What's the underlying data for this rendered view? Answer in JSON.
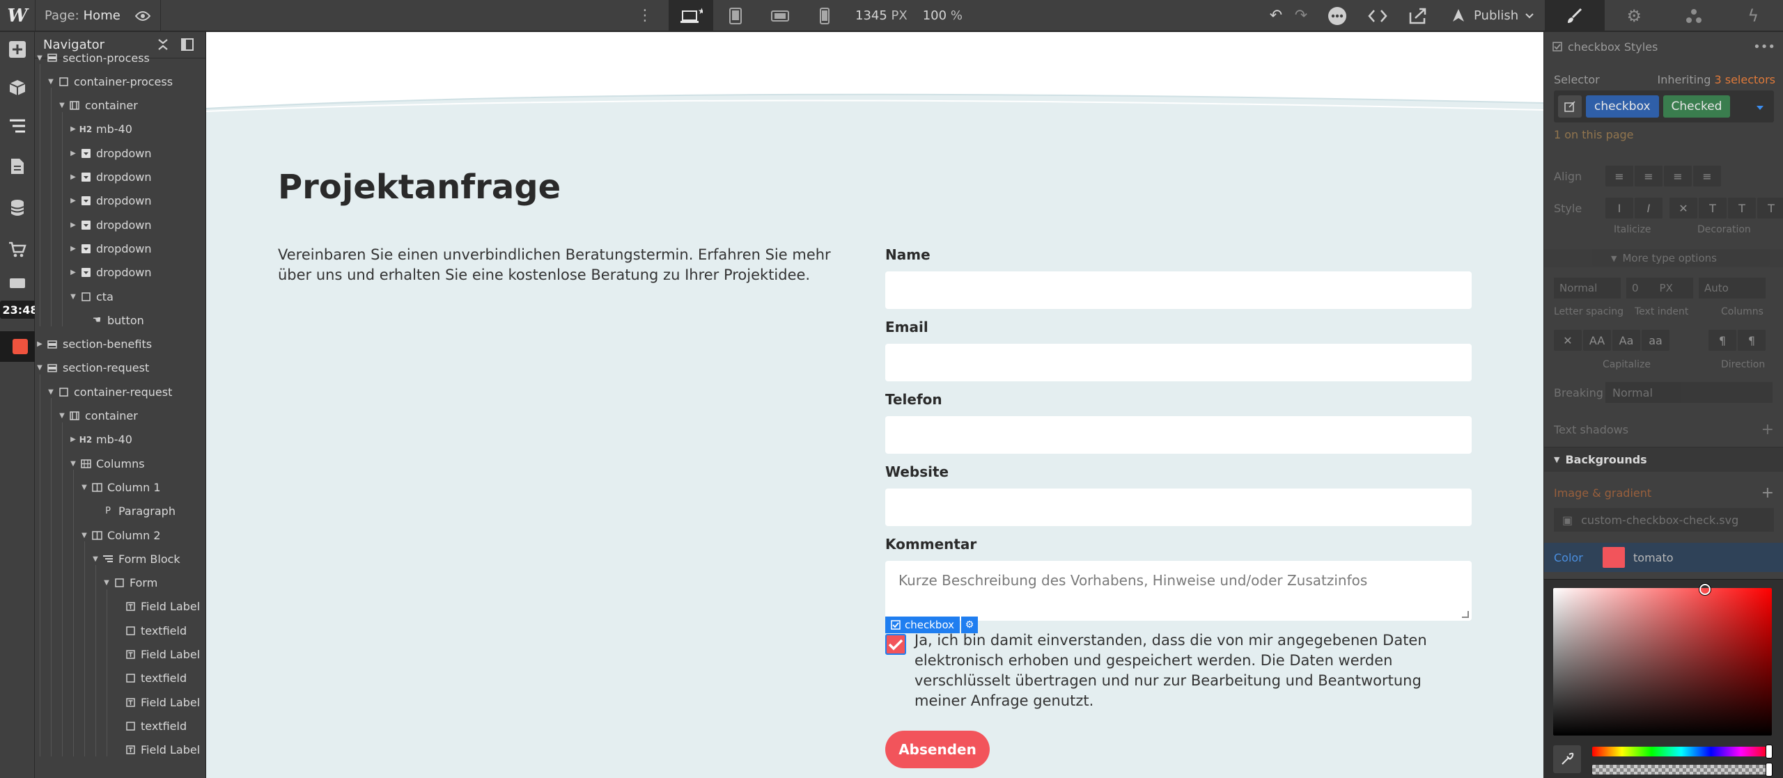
{
  "topbar": {
    "logo": "W",
    "page_label": "Page:",
    "page_name": "Home",
    "width_value": "1345",
    "width_unit": "PX",
    "zoom_value": "100",
    "zoom_unit": "%",
    "publish_label": "Publish"
  },
  "leftbar": {
    "timestamp": "23:48"
  },
  "navigator": {
    "title": "Navigator",
    "items": [
      {
        "label": "section-process"
      },
      {
        "label": "container-process"
      },
      {
        "label": "container"
      },
      {
        "label": "mb-40"
      },
      {
        "label": "dropdown"
      },
      {
        "label": "dropdown"
      },
      {
        "label": "dropdown"
      },
      {
        "label": "dropdown"
      },
      {
        "label": "dropdown"
      },
      {
        "label": "dropdown"
      },
      {
        "label": "cta"
      },
      {
        "label": "button"
      },
      {
        "label": "section-benefits"
      },
      {
        "label": "section-request"
      },
      {
        "label": "container-request"
      },
      {
        "label": "container"
      },
      {
        "label": "mb-40"
      },
      {
        "label": "Columns"
      },
      {
        "label": "Column 1"
      },
      {
        "label": "Paragraph"
      },
      {
        "label": "Column 2"
      },
      {
        "label": "Form Block"
      },
      {
        "label": "Form"
      },
      {
        "label": "Field Label"
      },
      {
        "label": "textfield"
      },
      {
        "label": "Field Label"
      },
      {
        "label": "textfield"
      },
      {
        "label": "Field Label"
      },
      {
        "label": "textfield"
      },
      {
        "label": "Field Label"
      }
    ]
  },
  "canvas": {
    "heading": "Projektanfrage",
    "lead": "Vereinbaren Sie einen unverbindlichen Beratungstermin. Erfahren Sie mehr über uns und erhalten Sie eine kostenlose Beratung zu Ihrer Projektidee.",
    "fields": [
      {
        "label": "Name"
      },
      {
        "label": "Email"
      },
      {
        "label": "Telefon"
      },
      {
        "label": "Website"
      }
    ],
    "comment_label": "Kommentar",
    "comment_placeholder": "Kurze Beschreibung des Vorhabens, Hinweise und/oder Zusatzinfos",
    "selected_tag": "checkbox",
    "consent": "Ja, ich bin damit einverstanden, dass die von mir angegebenen Daten elektronisch erhoben und gespeichert werden. Die Daten werden verschlüsselt übertragen und nur zur Bearbeitung und Beantwortung meiner Anfrage genutzt.",
    "submit_label": "Absenden"
  },
  "style_panel": {
    "title": "checkbox Styles",
    "selector_label": "Selector",
    "inheriting_text": "Inheriting",
    "inheriting_count": "3 selectors",
    "selector_class": "checkbox",
    "selector_state": "Checked",
    "on_page": "1 on this page",
    "align_label": "Align",
    "style_label": "Style",
    "italicize_label": "Italicize",
    "decoration_label": "Decoration",
    "more_type": "More type options",
    "letter_spacing_value": "Normal",
    "text_indent_value": "0",
    "text_indent_unit": "PX",
    "columns_value": "Auto",
    "letter_spacing_label": "Letter spacing",
    "text_indent_label": "Text indent",
    "columns_label": "Columns",
    "capitalize_label": "Capitalize",
    "direction_label": "Direction",
    "breaking_label": "Breaking",
    "breaking_value": "Normal",
    "text_shadows_label": "Text shadows",
    "backgrounds_label": "Backgrounds",
    "image_gradient_label": "Image & gradient",
    "bg_image": "custom-checkbox-check.svg",
    "color_label": "Color",
    "color_value": "tomato"
  },
  "colors": {
    "accent": "#f2545b",
    "selection": "#1f7ef0",
    "selector_class_bg": "#2f5fa8",
    "selector_state_bg": "#3a7d4e",
    "tomato": "#f2545b"
  }
}
